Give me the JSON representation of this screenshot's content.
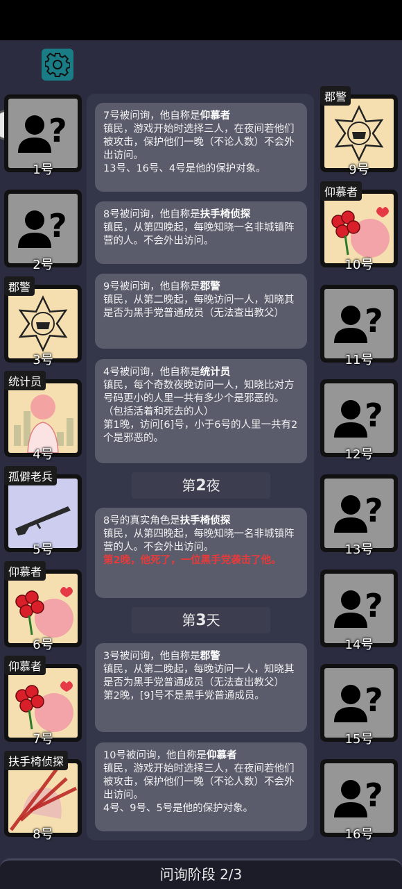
{
  "players_left": [
    {
      "num": "1号",
      "role": "",
      "art": "unknown"
    },
    {
      "num": "2号",
      "role": "",
      "art": "unknown"
    },
    {
      "num": "3号",
      "role": "郡警",
      "art": "sheriff"
    },
    {
      "num": "4号",
      "role": "统计员",
      "art": "statistician"
    },
    {
      "num": "5号",
      "role": "孤僻老兵",
      "art": "veteran"
    },
    {
      "num": "6号",
      "role": "仰慕者",
      "art": "admirer"
    },
    {
      "num": "7号",
      "role": "仰慕者",
      "art": "admirer"
    },
    {
      "num": "8号",
      "role": "扶手椅侦探",
      "art": "detective"
    }
  ],
  "players_right": [
    {
      "num": "9号",
      "role": "郡警",
      "art": "sheriff"
    },
    {
      "num": "10号",
      "role": "仰慕者",
      "art": "admirer"
    },
    {
      "num": "11号",
      "role": "",
      "art": "unknown"
    },
    {
      "num": "12号",
      "role": "",
      "art": "unknown"
    },
    {
      "num": "13号",
      "role": "",
      "art": "unknown"
    },
    {
      "num": "14号",
      "role": "",
      "art": "unknown"
    },
    {
      "num": "15号",
      "role": "",
      "art": "unknown"
    },
    {
      "num": "16号",
      "role": "",
      "art": "unknown"
    }
  ],
  "messages": [
    {
      "head": "7号被问询，他自称是",
      "role": "仰慕者",
      "body": "镇民，游戏开始时选择三人，在夜间若他们被攻击，保护他们一晚（不论人数）不会外出访问。",
      "extra": "13号、16号、4号是他的保护对象。",
      "red": ""
    },
    {
      "head": "8号被问询，他自称是",
      "role": "扶手椅侦探",
      "body": "镇民，从第四晚起，每晚知晓一名非城镇阵营的人。不会外出访问。",
      "extra": "",
      "red": ""
    },
    {
      "head": "9号被问询，他自称是",
      "role": "郡警",
      "body": "镇民，从第二晚起，每晚访问一人，知晓其是否为黑手党普通成员（无法查出教父）",
      "extra": "",
      "red": ""
    },
    {
      "head": "4号被问询，他自称是",
      "role": "统计员",
      "body": "镇民，每个奇数夜晚访问一人，知晓比对方号码更小的人里一共有多少个是邪恶的。（包括活着和死去的人）",
      "extra": "第1晚，访问[6]号，小于6号的人里一共有2个是邪恶的。",
      "red": ""
    },
    {
      "head": "8号的真实角色是",
      "role": "扶手椅侦探",
      "body": "镇民，从第四晚起，每晚知晓一名非城镇阵营的人。不会外出访问。",
      "extra": "",
      "red": "第2晚，他死了，一位黑手党袭击了他。"
    },
    {
      "head": "3号被问询，他自称是",
      "role": "郡警",
      "body": "镇民，从第二晚起，每晚访问一人，知晓其是否为黑手党普通成员（无法查出教父）",
      "extra": "第2晚，[9]号不是黑手党普通成员。",
      "red": ""
    },
    {
      "head": "10号被问询，他自称是",
      "role": "仰慕者",
      "body": "镇民，游戏开始时选择三人，在夜间若他们被攻击，保护他们一晚（不论人数）不会外出访问。",
      "extra": "4号、9号、5号是他的保护对象。",
      "red": ""
    }
  ],
  "phases": [
    {
      "pre": "第",
      "num": "2",
      "post": "夜"
    },
    {
      "pre": "第",
      "num": "3",
      "post": "天"
    }
  ],
  "footer": "问询阶段 2/3"
}
